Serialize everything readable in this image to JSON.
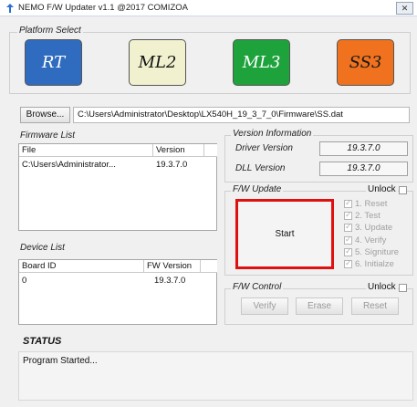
{
  "window": {
    "title": "NEMO F/W Updater v1.1 @2017 COMIZOA",
    "close_glyph": "✕"
  },
  "platform": {
    "legend": "Platform Select",
    "buttons": [
      {
        "label": "RT",
        "color": "#2f6cc0",
        "text_color": "#ffffff"
      },
      {
        "label": "ML2",
        "color": "#f1f1cf",
        "text_color": "#111111"
      },
      {
        "label": "ML3",
        "color": "#1ea33c",
        "text_color": "#ffffff"
      },
      {
        "label": "SS3",
        "color": "#f0721e",
        "text_color": "#1a1a1a"
      }
    ]
  },
  "browse": {
    "button": "Browse...",
    "path": "C:\\Users\\Administrator\\Desktop\\LX540H_19_3_7_0\\Firmware\\SS.dat"
  },
  "firmware_list": {
    "legend": "Firmware List",
    "columns": [
      "File",
      "Version"
    ],
    "rows": [
      [
        "C:\\Users\\Administrator...",
        "19.3.7.0"
      ]
    ]
  },
  "device_list": {
    "legend": "Device List",
    "columns": [
      "Board ID",
      "FW Version"
    ],
    "rows": [
      [
        "0",
        "19.3.7.0"
      ]
    ]
  },
  "version_info": {
    "legend": "Version Information",
    "driver_label": "Driver Version",
    "driver_value": "19.3.7.0",
    "dll_label": "DLL Version",
    "dll_value": "19.3.7.0"
  },
  "fw_update": {
    "legend": "F/W Update",
    "unlock_label": "Unlock",
    "start_label": "Start",
    "start_border_color": "#e01010",
    "steps": [
      "1. Reset",
      "2. Test",
      "3. Update",
      "4. Verify",
      "5. Signiture",
      "6. Initialze"
    ]
  },
  "fw_control": {
    "legend": "F/W Control",
    "unlock_label": "Unlock",
    "buttons": [
      "Verify",
      "Erase",
      "Reset"
    ]
  },
  "status": {
    "heading": "STATUS",
    "message": "Program Started..."
  }
}
